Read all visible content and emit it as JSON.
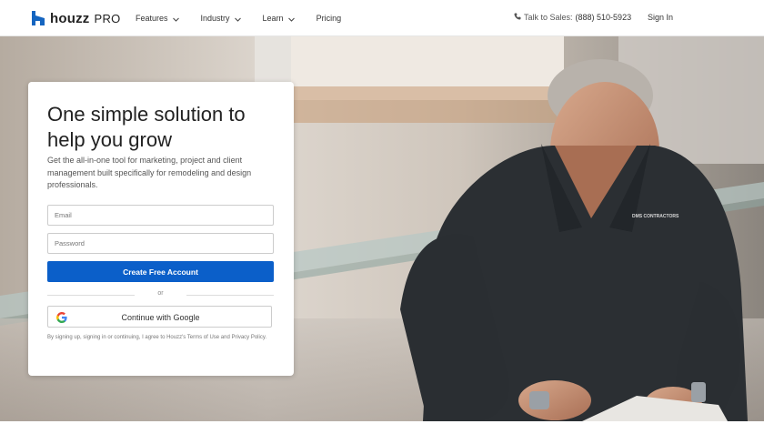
{
  "brand": {
    "name": "houzz",
    "suffix": "PRO",
    "color": "#1565c0"
  },
  "nav": {
    "items": [
      {
        "label": "Features",
        "has_dropdown": true
      },
      {
        "label": "Industry",
        "has_dropdown": true
      },
      {
        "label": "Learn",
        "has_dropdown": true
      },
      {
        "label": "Pricing",
        "has_dropdown": false
      }
    ],
    "talk_label": "Talk to Sales:",
    "talk_phone": "(888) 510-5923",
    "signin_label": "Sign In"
  },
  "hero": {
    "photo_icon": "contractor-photo",
    "shirt_text": "DMS CONTRACTORS"
  },
  "signup": {
    "title": "One simple solution to help you grow",
    "subtitle": "Get the all-in-one tool for marketing, project and client management built specifically for remodeling and design professionals.",
    "email_placeholder": "Email",
    "password_placeholder": "Password",
    "create_label": "Create Free Account",
    "or_label": "or",
    "google_label": "Continue with Google",
    "terms_prefix": "By signing up, signing in or continuing, I agree to Houzz's ",
    "terms_link": "Terms of Use",
    "terms_and": " and ",
    "privacy_link": "Privacy Policy",
    "terms_suffix": "."
  },
  "colors": {
    "primary_button": "#0b5fc9",
    "text_dark": "#222222"
  }
}
